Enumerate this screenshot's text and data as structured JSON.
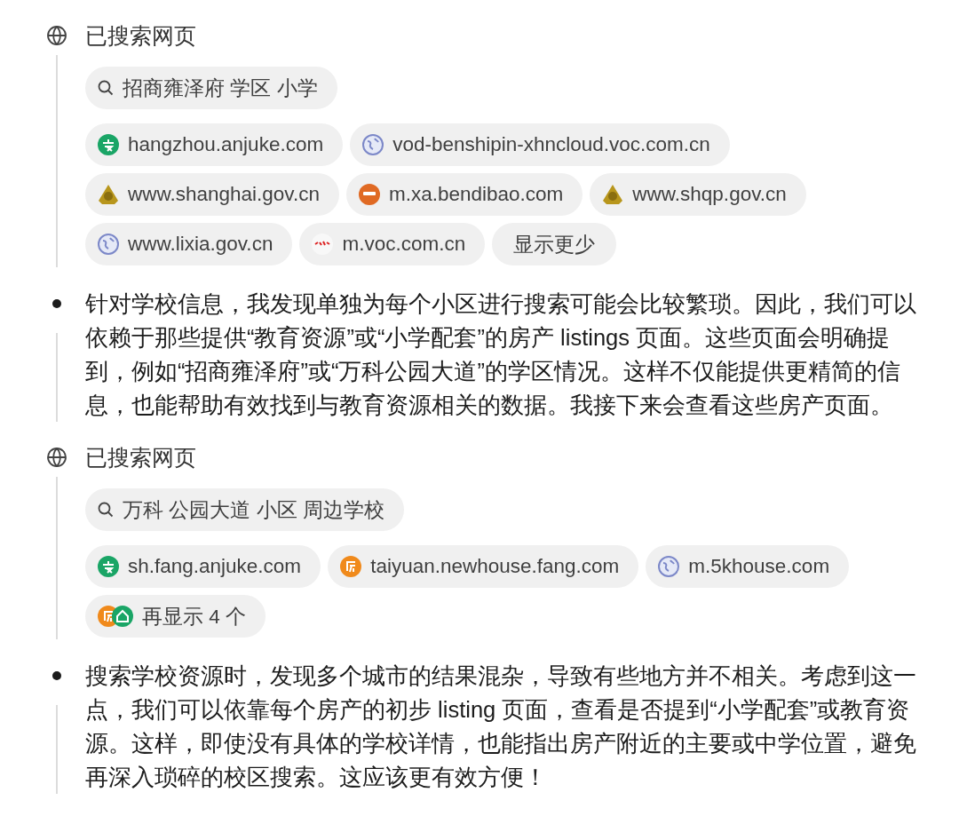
{
  "sections": [
    {
      "kind": "search",
      "title": "已搜索网页",
      "chips": [
        {
          "kind": "query",
          "label": "招商雍泽府 学区 小学"
        },
        {
          "kind": "site",
          "label": "hangzhou.anjuke.com",
          "favicons": [
            {
              "kind": "anjuke"
            }
          ]
        },
        {
          "kind": "site",
          "label": "vod-benshipin-xhncloud.voc.com.cn",
          "favicons": [
            {
              "kind": "globe"
            }
          ]
        },
        {
          "kind": "site",
          "label": "www.shanghai.gov.cn",
          "favicons": [
            {
              "kind": "emblem"
            }
          ]
        },
        {
          "kind": "site",
          "label": "m.xa.bendibao.com",
          "favicons": [
            {
              "kind": "bendibao"
            }
          ]
        },
        {
          "kind": "site",
          "label": "www.shqp.gov.cn",
          "favicons": [
            {
              "kind": "emblem"
            }
          ]
        },
        {
          "kind": "site",
          "label": "www.lixia.gov.cn",
          "favicons": [
            {
              "kind": "globe"
            }
          ]
        },
        {
          "kind": "site",
          "label": "m.voc.com.cn",
          "favicons": [
            {
              "kind": "voc"
            }
          ]
        },
        {
          "kind": "toggle",
          "label": "显示更少"
        }
      ]
    },
    {
      "kind": "thought",
      "text": "针对学校信息，我发现单独为每个小区进行搜索可能会比较繁琐。因此，我们可以依赖于那些提供“教育资源”或“小学配套”的房产 listings 页面。这些页面会明确提到，例如“招商雍泽府”或“万科公园大道”的学区情况。这样不仅能提供更精简的信息，也能帮助有效找到与教育资源相关的数据。我接下来会查看这些房产页面。"
    },
    {
      "kind": "search",
      "title": "已搜索网页",
      "chips": [
        {
          "kind": "query",
          "label": "万科 公园大道 小区 周边学校"
        },
        {
          "kind": "site",
          "label": "sh.fang.anjuke.com",
          "favicons": [
            {
              "kind": "anjuke"
            }
          ]
        },
        {
          "kind": "site",
          "label": "taiyuan.newhouse.fang.com",
          "favicons": [
            {
              "kind": "fang"
            }
          ]
        },
        {
          "kind": "site",
          "label": "m.5khouse.com",
          "favicons": [
            {
              "kind": "globe"
            }
          ]
        },
        {
          "kind": "toggle",
          "label": "再显示 4 个",
          "favicons": [
            {
              "kind": "fang"
            },
            {
              "kind": "house"
            }
          ]
        }
      ]
    },
    {
      "kind": "thought",
      "text": "搜索学校资源时，发现多个城市的结果混杂，导致有些地方并不相关。考虑到这一点，我们可以依靠每个房产的初步 listing 页面，查看是否提到“小学配套”或教育资源。这样，即使没有具体的学校详情，也能指出房产附近的主要或中学位置，避免再深入琐碎的校区搜索。这应该更有效方便！"
    }
  ]
}
